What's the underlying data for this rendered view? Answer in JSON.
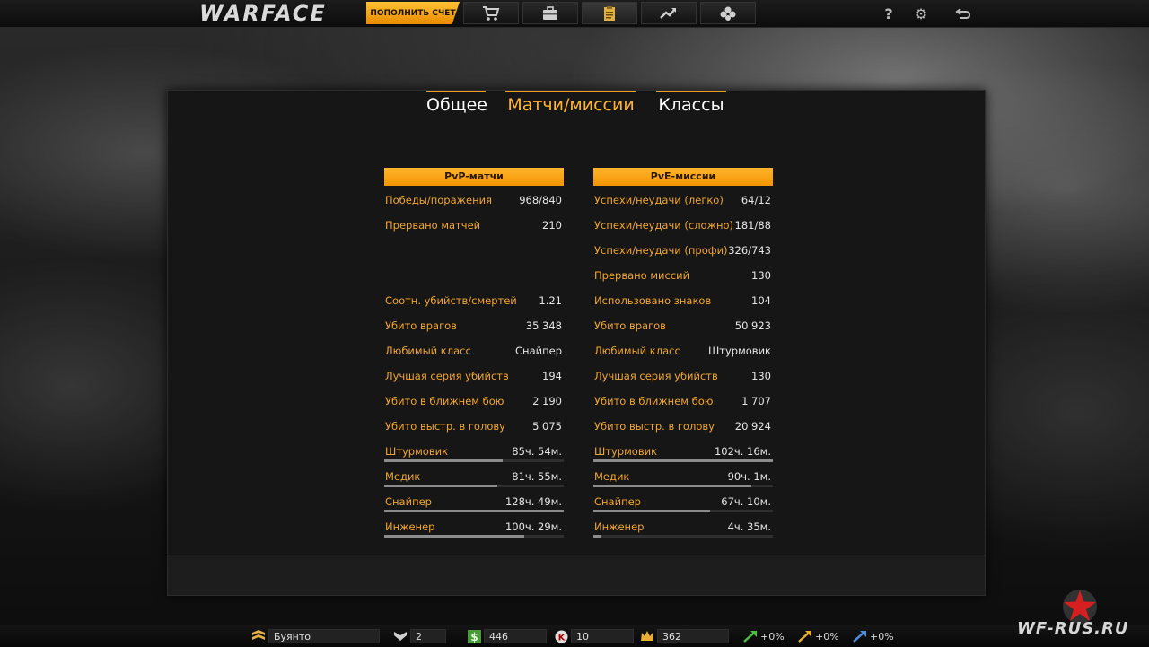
{
  "header": {
    "logo_text": "WARFACE",
    "fund_button": "ПОПОЛНИТЬ СЧЕТ",
    "nav_icons": [
      "cart-icon",
      "briefcase-icon",
      "clipboard-icon",
      "chart-arrow-icon",
      "clover-icon"
    ],
    "system": {
      "help": "?",
      "settings": "⚙",
      "exit": "⮌"
    }
  },
  "tabs": [
    {
      "label": "Общее",
      "active": false
    },
    {
      "label": "Матчи/миссии",
      "active": true
    },
    {
      "label": "Классы",
      "active": false
    }
  ],
  "pvp": {
    "title": "PvP-матчи",
    "stats": [
      {
        "label": "Победы/поражения",
        "value": "968/840"
      },
      {
        "label": "Прервано матчей",
        "value": "210"
      },
      {
        "label": "Соотн. убийств/смертей",
        "value": "1.21"
      },
      {
        "label": "Убито врагов",
        "value": "35 348"
      },
      {
        "label": "Любимый класс",
        "value": "Снайпер"
      },
      {
        "label": "Лучшая серия убийств",
        "value": "194"
      },
      {
        "label": "Убито в ближнем бою",
        "value": "2 190"
      },
      {
        "label": "Убито выстр. в голову",
        "value": "5 075"
      }
    ],
    "classes": [
      {
        "label": "Штурмовик",
        "value": "85ч. 54м.",
        "fraction": 0.66
      },
      {
        "label": "Медик",
        "value": "81ч. 55м.",
        "fraction": 0.63
      },
      {
        "label": "Снайпер",
        "value": "128ч. 49м.",
        "fraction": 1.0
      },
      {
        "label": "Инженер",
        "value": "100ч. 29м.",
        "fraction": 0.78
      }
    ]
  },
  "pve": {
    "title": "PvE-миссии",
    "stats": [
      {
        "label": "Успехи/неудачи (легко)",
        "value": "64/12"
      },
      {
        "label": "Успехи/неудачи (сложно)",
        "value": "181/88"
      },
      {
        "label": "Успехи/неудачи (профи)",
        "value": "326/743"
      },
      {
        "label": "Прервано миссий",
        "value": "130"
      },
      {
        "label": "Использовано знаков",
        "value": "104"
      },
      {
        "label": "Убито врагов",
        "value": "50 923"
      },
      {
        "label": "Любимый класс",
        "value": "Штурмовик"
      },
      {
        "label": "Лучшая серия убийств",
        "value": "130"
      },
      {
        "label": "Убито в ближнем бою",
        "value": "1 707"
      },
      {
        "label": "Убито выстр. в голову",
        "value": "20 924"
      }
    ],
    "classes": [
      {
        "label": "Штурмовик",
        "value": "102ч. 16м.",
        "fraction": 1.0
      },
      {
        "label": "Медик",
        "value": "90ч. 1м.",
        "fraction": 0.88
      },
      {
        "label": "Снайпер",
        "value": "67ч. 10м.",
        "fraction": 0.65
      },
      {
        "label": "Инженер",
        "value": "4ч. 35м.",
        "fraction": 0.04
      }
    ]
  },
  "footer": {
    "player_name": "Буянто",
    "rank": "2",
    "money": "446",
    "kredits": "10",
    "crowns": "362",
    "boosts": [
      "+0%",
      "+0%",
      "+0%"
    ]
  },
  "watermark": "WF-RUS.RU",
  "colors": {
    "accent": "#f29500",
    "label": "#f1a630",
    "value": "#e6e6e6"
  }
}
